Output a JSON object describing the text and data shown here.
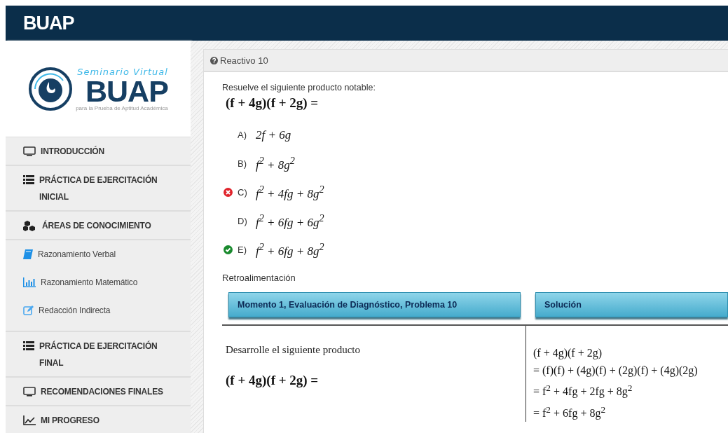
{
  "header": {
    "brand": "BUAP"
  },
  "logo": {
    "tagline": "Seminario Virtual",
    "name": "BUAP",
    "subtitle": "para la Prueba de Aptitud Académica"
  },
  "sidebar": {
    "items": [
      {
        "kind": "section",
        "label": "INTRODUCCIÓN"
      },
      {
        "kind": "section",
        "label": "PRÁCTICA DE EJERCITACIÓN INICIAL"
      },
      {
        "kind": "section",
        "label": "ÁREAS DE CONOCIMIENTO"
      },
      {
        "kind": "sub",
        "label": "Razonamiento Verbal"
      },
      {
        "kind": "sub",
        "label": "Razonamiento Matemático"
      },
      {
        "kind": "sub",
        "label": "Redacción Indirecta"
      },
      {
        "kind": "section",
        "label": "PRÁCTICA DE EJERCITACIÓN FINAL"
      },
      {
        "kind": "section",
        "label": "RECOMENDACIONES FINALES"
      },
      {
        "kind": "section",
        "label": "MI PROGRESO"
      }
    ]
  },
  "question": {
    "title": "Reactivo 10",
    "prompt": "Resuelve el siguiente producto notable:",
    "formula": "(f + 4g)(f + 2g) =",
    "options": [
      {
        "letter": "A)",
        "formula": "2f + 6g",
        "correct": false,
        "incorrect": false
      },
      {
        "letter": "B)",
        "formula": "f$^{2}$ + 8g$^{2}$",
        "correct": false,
        "incorrect": false
      },
      {
        "letter": "C)",
        "formula": "f$^{2}$ + 4fg + 8g$^{2}$",
        "correct": false,
        "incorrect": true
      },
      {
        "letter": "D)",
        "formula": "f$^{2}$ + 6fg + 6g$^{2}$",
        "correct": false,
        "incorrect": false
      },
      {
        "letter": "E)",
        "formula": "f$^{2}$ + 6fg + 8g$^{2}$",
        "correct": true,
        "incorrect": false
      }
    ]
  },
  "feedback": {
    "title": "Retroalimentación",
    "columns": [
      "Momento 1, Evaluación de Diagnóstico, Problema 10",
      "Solución"
    ],
    "statement": "Desarrolle el siguiente producto",
    "formula": "(f + 4g)(f + 2g) =",
    "solution": [
      "(f + 4g)(f + 2g)",
      "= (f)(f) + (4g)(f) + (2g)(f) + (4g)(2g)",
      "= f$^{2}$ + 4fg + 2fg + 8g$^{2}$",
      "= f$^{2}$ + 6fg + 8g$^{2}$"
    ]
  }
}
